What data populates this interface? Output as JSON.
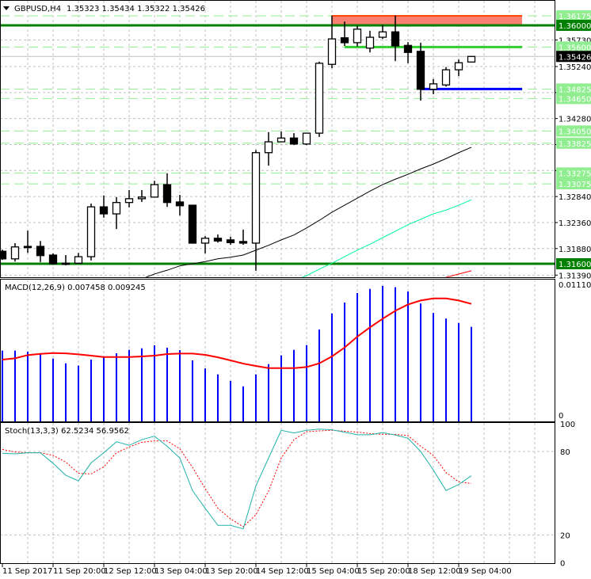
{
  "chart_data": [
    {
      "type": "candlestick",
      "symbol": "GBPUSD,H4",
      "ohlc_header": "1.35323 1.35434 1.35322 1.35426",
      "x_tick_labels": [
        "11 Sep 2017",
        "11 Sep 20:00",
        "12 Sep 12:00",
        "13 Sep 04:00",
        "13 Sep 20:00",
        "14 Sep 12:00",
        "15 Sep 04:00",
        "15 Sep 20:00",
        "18 Sep 12:00",
        "19 Sep 04:00"
      ],
      "x_tick_every_bars": 4,
      "y_tick_labels": [
        "1.35730",
        "1.35240",
        "1.34280",
        "1.32840",
        "1.32360",
        "1.31880",
        "1.31390"
      ],
      "y_grid": [
        1.3573,
        1.3524,
        1.3476,
        1.3428,
        1.338,
        1.3332,
        1.3284,
        1.3236,
        1.3188,
        1.3139
      ],
      "grid": true,
      "candles": [
        {
          "o": 1.3183,
          "h": 1.3186,
          "l": 1.3167,
          "c": 1.3169
        },
        {
          "o": 1.3169,
          "h": 1.3198,
          "l": 1.3164,
          "c": 1.3191
        },
        {
          "o": 1.3192,
          "h": 1.3221,
          "l": 1.318,
          "c": 1.319
        },
        {
          "o": 1.3192,
          "h": 1.3202,
          "l": 1.3163,
          "c": 1.3175
        },
        {
          "o": 1.3176,
          "h": 1.3179,
          "l": 1.3158,
          "c": 1.316
        },
        {
          "o": 1.3161,
          "h": 1.3176,
          "l": 1.3157,
          "c": 1.316
        },
        {
          "o": 1.3161,
          "h": 1.318,
          "l": 1.316,
          "c": 1.3173
        },
        {
          "o": 1.3173,
          "h": 1.3271,
          "l": 1.3166,
          "c": 1.3265
        },
        {
          "o": 1.3265,
          "h": 1.3286,
          "l": 1.3245,
          "c": 1.3252
        },
        {
          "o": 1.3252,
          "h": 1.3283,
          "l": 1.3224,
          "c": 1.3273
        },
        {
          "o": 1.3273,
          "h": 1.3296,
          "l": 1.3264,
          "c": 1.328
        },
        {
          "o": 1.328,
          "h": 1.3296,
          "l": 1.3274,
          "c": 1.3283
        },
        {
          "o": 1.3283,
          "h": 1.3313,
          "l": 1.3282,
          "c": 1.3306
        },
        {
          "o": 1.3306,
          "h": 1.3327,
          "l": 1.3265,
          "c": 1.3273
        },
        {
          "o": 1.3274,
          "h": 1.3287,
          "l": 1.3249,
          "c": 1.3267
        },
        {
          "o": 1.3268,
          "h": 1.3269,
          "l": 1.3197,
          "c": 1.3198
        },
        {
          "o": 1.3198,
          "h": 1.3211,
          "l": 1.3179,
          "c": 1.3207
        },
        {
          "o": 1.3207,
          "h": 1.3214,
          "l": 1.3199,
          "c": 1.3202
        },
        {
          "o": 1.3204,
          "h": 1.321,
          "l": 1.3195,
          "c": 1.3199
        },
        {
          "o": 1.3201,
          "h": 1.3223,
          "l": 1.3195,
          "c": 1.3198
        },
        {
          "o": 1.3198,
          "h": 1.337,
          "l": 1.3147,
          "c": 1.3365
        },
        {
          "o": 1.3365,
          "h": 1.3403,
          "l": 1.3341,
          "c": 1.3385
        },
        {
          "o": 1.3385,
          "h": 1.3404,
          "l": 1.3384,
          "c": 1.3392
        },
        {
          "o": 1.3392,
          "h": 1.3401,
          "l": 1.3379,
          "c": 1.3381
        },
        {
          "o": 1.3381,
          "h": 1.3402,
          "l": 1.3379,
          "c": 1.3401
        },
        {
          "o": 1.3401,
          "h": 1.3533,
          "l": 1.3394,
          "c": 1.353
        },
        {
          "o": 1.3528,
          "h": 1.3618,
          "l": 1.3521,
          "c": 1.3575
        },
        {
          "o": 1.3577,
          "h": 1.3607,
          "l": 1.3562,
          "c": 1.3568
        },
        {
          "o": 1.3568,
          "h": 1.3599,
          "l": 1.3561,
          "c": 1.3593
        },
        {
          "o": 1.3558,
          "h": 1.359,
          "l": 1.355,
          "c": 1.3578
        },
        {
          "o": 1.3578,
          "h": 1.3601,
          "l": 1.3575,
          "c": 1.3588
        },
        {
          "o": 1.3588,
          "h": 1.3618,
          "l": 1.3534,
          "c": 1.3562
        },
        {
          "o": 1.3563,
          "h": 1.3569,
          "l": 1.353,
          "c": 1.355
        },
        {
          "o": 1.3552,
          "h": 1.3568,
          "l": 1.3461,
          "c": 1.3482
        },
        {
          "o": 1.3482,
          "h": 1.3501,
          "l": 1.3473,
          "c": 1.3492
        },
        {
          "o": 1.349,
          "h": 1.3523,
          "l": 1.3487,
          "c": 1.3518
        },
        {
          "o": 1.3518,
          "h": 1.3537,
          "l": 1.3506,
          "c": 1.3531
        },
        {
          "o": 1.35323,
          "h": 1.35434,
          "l": 1.35322,
          "c": 1.35426
        }
      ],
      "moving_averages": [
        {
          "color": "#000000",
          "start_index": 11,
          "values": [
            1.3132,
            1.3141,
            1.3148,
            1.3156,
            1.316,
            1.3164,
            1.3169,
            1.3172,
            1.3176,
            1.3185,
            1.3194,
            1.3204,
            1.3213,
            1.3226,
            1.324,
            1.3255,
            1.3268,
            1.3281,
            1.3294,
            1.3306,
            1.3316,
            1.3325,
            1.3335,
            1.3344,
            1.3354,
            1.3365,
            1.3375
          ]
        },
        {
          "color": "#00fa9a",
          "start_index": 23,
          "values": [
            1.3129,
            1.3138,
            1.315,
            1.3161,
            1.3173,
            1.3185,
            1.3196,
            1.3208,
            1.322,
            1.3232,
            1.3242,
            1.3252,
            1.3259,
            1.3268,
            1.3278
          ]
        },
        {
          "color": "#ff0000",
          "start_index": 35,
          "values": [
            1.3135,
            1.3141,
            1.3147
          ]
        }
      ],
      "current_price": {
        "value": 1.35426,
        "label": "1.35426",
        "color": "#000000"
      },
      "levels": [
        {
          "price": 1.36175,
          "label": "1.36175",
          "style": "dashed",
          "color": "#90ee90"
        },
        {
          "price": 1.36,
          "label": "1.36000",
          "style": "solid",
          "color": "#008000"
        },
        {
          "price": 1.356,
          "label": "1.35600",
          "style": "dashed",
          "color": "#90ee90"
        },
        {
          "price": 1.34825,
          "label": "1.34825",
          "style": "dashed",
          "color": "#90ee90"
        },
        {
          "price": 1.3465,
          "label": "1.34650",
          "style": "dashed",
          "color": "#90ee90"
        },
        {
          "price": 1.3405,
          "label": "1.34050",
          "style": "dashed",
          "color": "#90ee90"
        },
        {
          "price": 1.33825,
          "label": "1.33825",
          "style": "dashed",
          "color": "#90ee90"
        },
        {
          "price": 1.33275,
          "label": "1.33275",
          "style": "dashed",
          "color": "#90ee90"
        },
        {
          "price": 1.33075,
          "label": "1.33075",
          "style": "dashed",
          "color": "#90ee90"
        },
        {
          "price": 1.316,
          "label": "1.31600",
          "style": "solid",
          "color": "#008000"
        }
      ],
      "segments": [
        {
          "price": 1.356,
          "from_index": 27,
          "to_index": 41,
          "color": "#32cd32"
        },
        {
          "price": 1.34825,
          "from_index": 33,
          "to_index": 41,
          "color": "#0000ff"
        }
      ],
      "zone": {
        "from_price": 1.36,
        "to_price": 1.36175,
        "from_index": 26,
        "to_index": 41,
        "fill": "#fa8072",
        "border": "#ff4500"
      }
    },
    {
      "type": "bar",
      "title": "MACD(12,26,9) 0.007458 0.009245",
      "y_tick_labels": [
        "0.011109",
        "0"
      ],
      "histogram_color": "#0000ff",
      "signal_color": "#ff0000",
      "histogram": [
        0.00561,
        0.00561,
        0.00553,
        0.00536,
        0.00499,
        0.00462,
        0.00444,
        0.00491,
        0.00509,
        0.0054,
        0.00567,
        0.00579,
        0.00602,
        0.00583,
        0.00565,
        0.00485,
        0.00423,
        0.00376,
        0.00325,
        0.00283,
        0.00376,
        0.00456,
        0.00524,
        0.00567,
        0.00604,
        0.00725,
        0.0085,
        0.00935,
        0.01009,
        0.01041,
        0.01064,
        0.01054,
        0.01021,
        0.00928,
        0.00854,
        0.00811,
        0.00776,
        0.007458
      ],
      "signal": [
        0.00491,
        0.00501,
        0.00526,
        0.00536,
        0.00542,
        0.0054,
        0.00532,
        0.00522,
        0.00511,
        0.00511,
        0.00511,
        0.00516,
        0.00522,
        0.00534,
        0.00538,
        0.00538,
        0.00528,
        0.00509,
        0.00485,
        0.0046,
        0.00442,
        0.00425,
        0.00425,
        0.00425,
        0.00433,
        0.00462,
        0.00516,
        0.00585,
        0.0067,
        0.00742,
        0.00809,
        0.00871,
        0.0092,
        0.00951,
        0.00967,
        0.00967,
        0.00951,
        0.009245
      ]
    },
    {
      "type": "line",
      "title": "Stoch(13,3,3) 62.5234 56.9562",
      "y_tick_labels": [
        "100",
        "80",
        "20",
        "0"
      ],
      "levels": [
        80,
        20
      ],
      "main_color": "#20b2aa",
      "signal_color": "#ff0000",
      "main": [
        78.7,
        78.3,
        79.1,
        79.1,
        71.5,
        62.9,
        58.9,
        71.8,
        79.1,
        87.0,
        84.4,
        88.5,
        91.0,
        83.8,
        75.3,
        51.9,
        39.2,
        26.9,
        26.9,
        24.4,
        55.3,
        75.3,
        95.2,
        93.3,
        95.2,
        96.1,
        95.6,
        93.9,
        92.0,
        92.0,
        93.5,
        91.8,
        89.5,
        80.0,
        66.7,
        51.9,
        56.3,
        62.5234
      ],
      "signal": [
        81.5,
        79.6,
        79.1,
        79.1,
        77.2,
        72.4,
        64.3,
        63.9,
        69.0,
        79.1,
        83.2,
        86.6,
        87.6,
        87.6,
        81.9,
        68.6,
        53.4,
        39.2,
        31.6,
        25.9,
        34.5,
        51.5,
        75.3,
        88.5,
        94.2,
        94.8,
        95.2,
        94.6,
        93.9,
        92.9,
        92.3,
        92.3,
        91.4,
        83.8,
        77.2,
        64.8,
        58.2,
        56.9562
      ]
    }
  ]
}
